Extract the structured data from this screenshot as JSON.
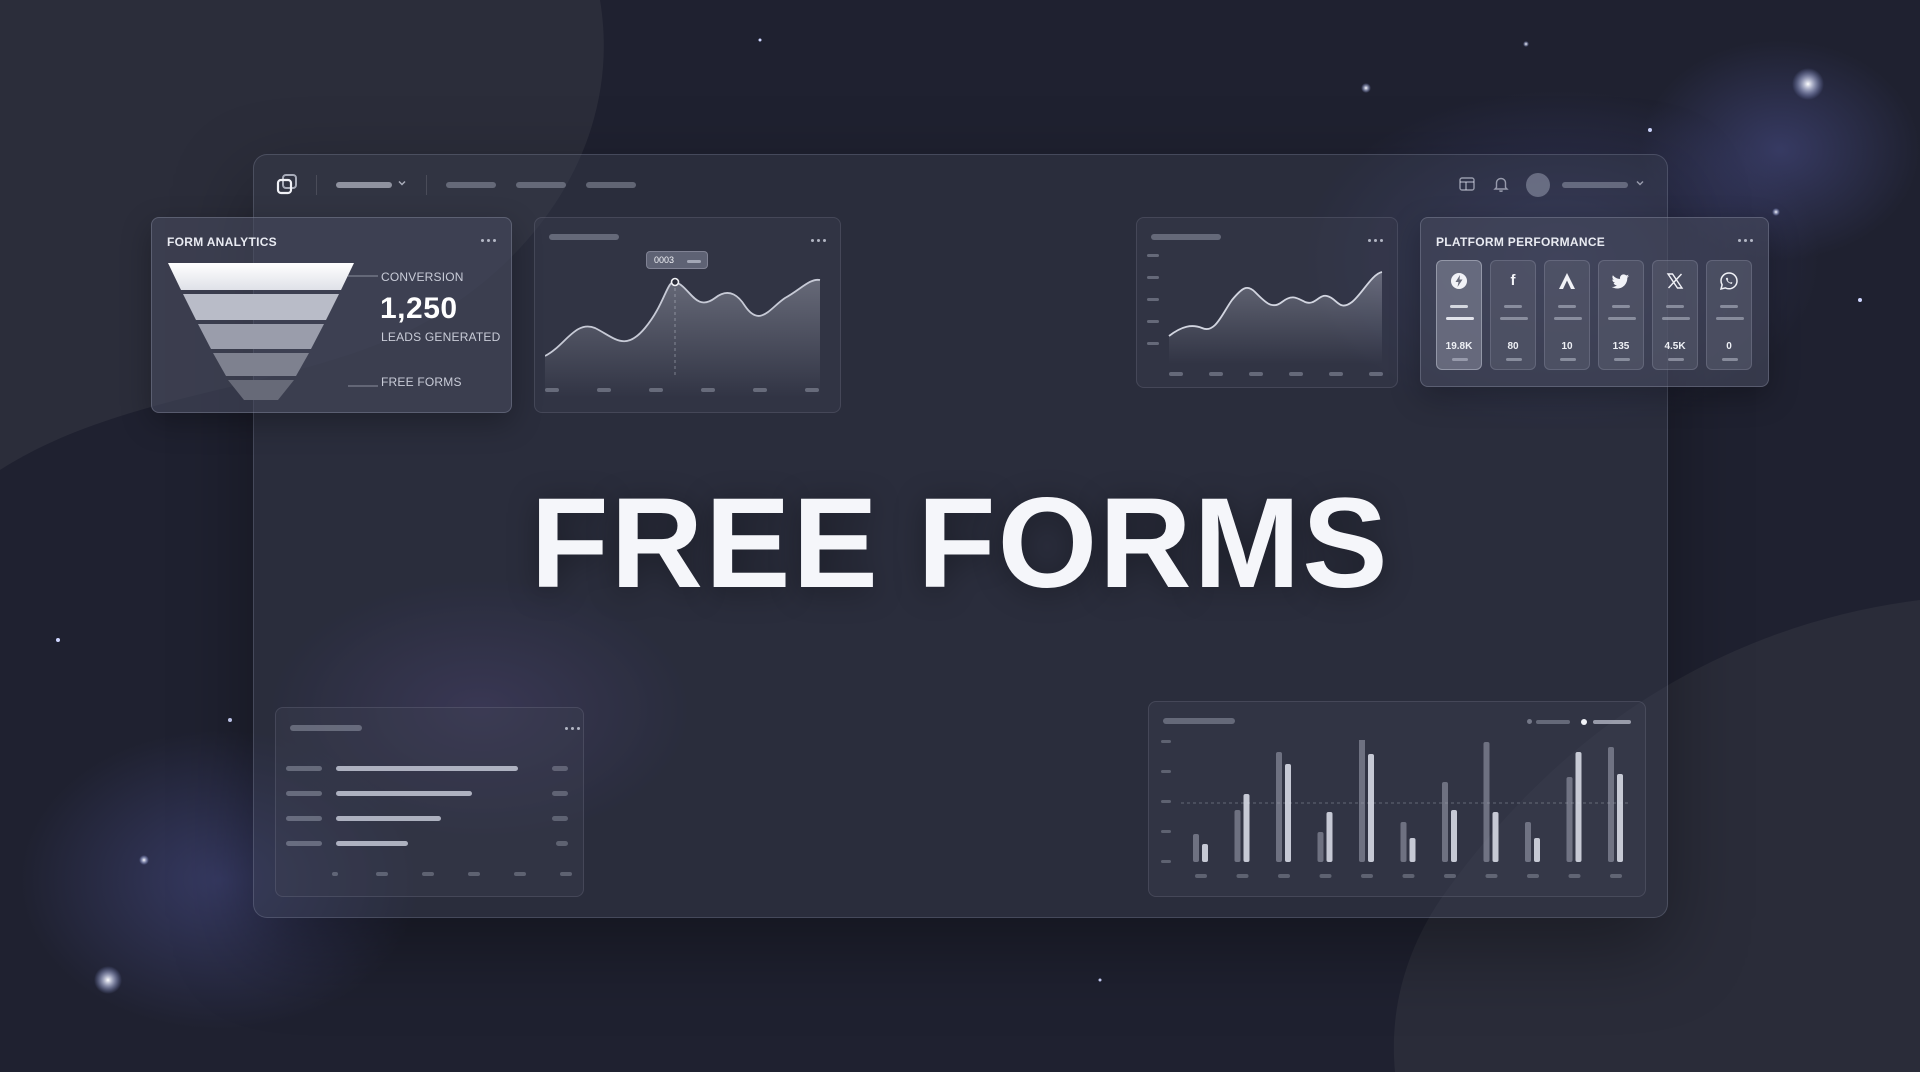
{
  "hero": {
    "title": "FREE FORMS"
  },
  "form_analytics": {
    "title": "FORM ANALYTICS",
    "conversion_label": "CONVERSION",
    "leads_value": "1,250",
    "leads_label": "LEADS GENERATED",
    "bottom_label": "FREE FORMS"
  },
  "line_chart": {
    "tooltip_value": "0003"
  },
  "platform_performance": {
    "title": "PLATFORM PERFORMANCE",
    "platforms": [
      {
        "icon": "bolt-icon",
        "value": "19.8K",
        "active": true
      },
      {
        "icon": "facebook-icon",
        "value": "80",
        "active": false
      },
      {
        "icon": "a-logo-icon",
        "value": "10",
        "active": false
      },
      {
        "icon": "twitter-bird-icon",
        "value": "135",
        "active": false
      },
      {
        "icon": "x-logo-icon",
        "value": "4.5K",
        "active": false
      },
      {
        "icon": "whatsapp-icon",
        "value": "0",
        "active": false
      }
    ]
  },
  "colors": {
    "background": "#20222e",
    "card": "#464a5c",
    "text": "#e8eaf0",
    "accent_white": "#ffffff"
  }
}
